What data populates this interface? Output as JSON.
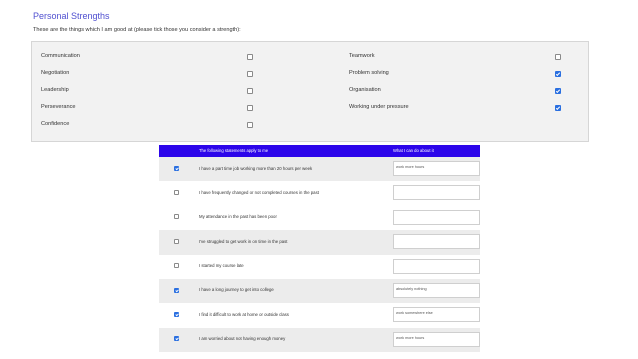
{
  "section": {
    "title": "Personal Strengths",
    "intro": "These are the things which I am good at (please tick those you consider a strength):"
  },
  "strengths": {
    "left": [
      {
        "label": "Communication",
        "checked": false
      },
      {
        "label": "Negotiation",
        "checked": false
      },
      {
        "label": "Leadership",
        "checked": false
      },
      {
        "label": "Perseverance",
        "checked": false
      },
      {
        "label": "Confidence",
        "checked": false
      }
    ],
    "right": [
      {
        "label": "Teamwork",
        "checked": false
      },
      {
        "label": "Problem solving",
        "checked": true
      },
      {
        "label": "Organisation",
        "checked": true
      },
      {
        "label": "Working under pressure",
        "checked": true
      }
    ]
  },
  "statements_table": {
    "header_statement": "The following statements apply to me",
    "header_action": "What I can do about it",
    "rows": [
      {
        "text": "I have a part time job working more than 20 hours per week",
        "checked": true,
        "action": "work more hours"
      },
      {
        "text": "I have frequently changed or not completed courses in the past",
        "checked": false,
        "action": ""
      },
      {
        "text": "My attendance in the past has been poor",
        "checked": false,
        "action": ""
      },
      {
        "text": "I've struggled to get work in on time in the past",
        "checked": false,
        "action": ""
      },
      {
        "text": "I started my course late",
        "checked": false,
        "action": ""
      },
      {
        "text": "I have a long journey to get into college",
        "checked": true,
        "action": "absolutely nothing"
      },
      {
        "text": "I find it difficult to work at home or outside class",
        "checked": true,
        "action": "work somewhere else"
      },
      {
        "text": "I am worried about not having enough money",
        "checked": true,
        "action": "work more hours"
      }
    ]
  },
  "colors": {
    "heading": "#5050d0",
    "table_header": "#2c05ea",
    "checkbox_checked": "#2a6fe0"
  }
}
